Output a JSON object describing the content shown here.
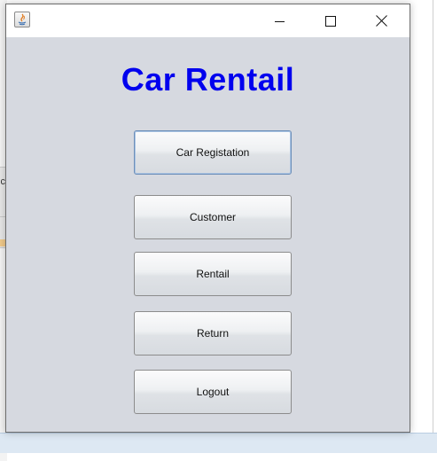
{
  "window": {
    "title": "",
    "app_icon": "java-icon",
    "controls": {
      "minimize": "minimize-icon",
      "maximize": "maximize-icon",
      "close": "close-icon"
    }
  },
  "main": {
    "heading": "Car Rentail",
    "heading_color": "#0000ee",
    "buttons": [
      {
        "label": "Car Registation",
        "focused": true
      },
      {
        "label": "Customer",
        "focused": false
      },
      {
        "label": "Rentail",
        "focused": false
      },
      {
        "label": "Return",
        "focused": false
      },
      {
        "label": "Logout",
        "focused": false
      }
    ]
  },
  "background": {
    "left_fragment_text": "ic"
  }
}
